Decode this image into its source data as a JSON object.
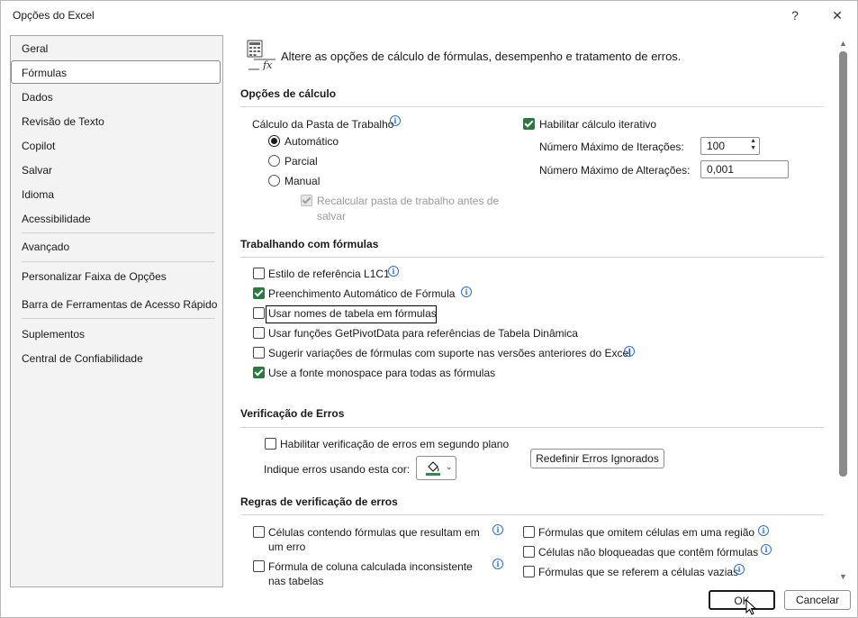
{
  "window": {
    "title": "Opções do Excel",
    "help_glyph": "?",
    "close_glyph": "✕"
  },
  "sidebar": {
    "items": [
      {
        "label": "Geral"
      },
      {
        "label": "Fórmulas",
        "selected": true
      },
      {
        "label": "Dados"
      },
      {
        "label": "Revisão de Texto"
      },
      {
        "label": "Copilot"
      },
      {
        "label": "Salvar"
      },
      {
        "label": "Idioma"
      },
      {
        "label": "Acessibilidade"
      },
      {
        "label": "Avançado"
      },
      {
        "label": "Personalizar Faixa de Opções"
      },
      {
        "label": "Barra de Ferramentas de Acesso Rápido"
      },
      {
        "label": "Suplementos"
      },
      {
        "label": "Central de Confiabilidade"
      }
    ]
  },
  "header": {
    "icon": "formula-settings-icon",
    "description": "Altere as opções de cálculo de fórmulas, desempenho e tratamento de erros."
  },
  "calc": {
    "section_title": "Opções de cálculo",
    "workbook_calc_label": "Cálculo da Pasta de Trabalho",
    "radio_auto": "Automático",
    "radio_partial": "Parcial",
    "radio_manual": "Manual",
    "recalc_line1": "Recalcular pasta de trabalho antes de",
    "recalc_line2": "salvar",
    "iterative_label": "Habilitar cálculo iterativo",
    "max_iter_label": "Número Máximo de Iterações:",
    "max_iter_value": "100",
    "max_change_label": "Número Máximo de Alterações:",
    "max_change_value": "0,001"
  },
  "formulas": {
    "section_title": "Trabalhando com fórmulas",
    "items": [
      {
        "label": "Estilo de referência L1C1",
        "checked": false
      },
      {
        "label": "Preenchimento Automático de Fórmula",
        "checked": true
      },
      {
        "label": "Usar nomes de tabela em fórmulas",
        "checked": false
      },
      {
        "label": "Usar funções GetPivotData para referências de Tabela Dinâmica",
        "checked": false
      },
      {
        "label": "Sugerir variações de fórmulas com suporte nas versões anteriores do Excel",
        "checked": false
      },
      {
        "label": "Use a fonte monospace para todas as fórmulas",
        "checked": true
      }
    ]
  },
  "errors": {
    "section_title": "Verificação de Erros",
    "bg_check_label": "Habilitar verificação de erros em segundo plano",
    "color_label": "Indique erros usando esta cor:",
    "color_value": "#2e8b57",
    "reset_button": "Redefinir Erros Ignorados"
  },
  "rules": {
    "section_title": "Regras de verificação de erros",
    "left": [
      {
        "line1": "Células contendo fórmulas que resultam em",
        "line2": "um erro"
      },
      {
        "line1": "Fórmula de coluna calculada inconsistente",
        "line2": "nas tabelas"
      }
    ],
    "right": [
      "Fórmulas que omitem células em uma região",
      "Células não bloqueadas que contêm fórmulas",
      "Fórmulas que se referem a células vazias"
    ]
  },
  "footer": {
    "ok_label": "OK",
    "cancel_label": "Cancelar"
  }
}
